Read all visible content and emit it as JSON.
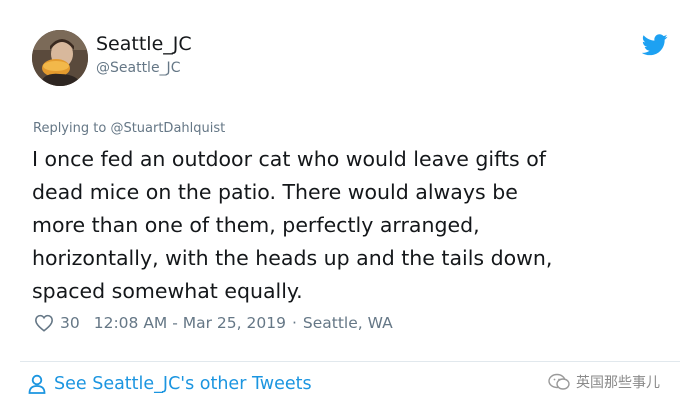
{
  "user": {
    "display_name": "Seattle_JC",
    "handle": "@Seattle_JC"
  },
  "reply": {
    "prefix": "Replying to",
    "to": "@StuartDahlquist"
  },
  "tweet": {
    "line1": "I once fed an outdoor cat who would leave gifts of",
    "line2": "dead mice on the patio. There would always be",
    "line3": "more than one of them, perfectly arranged,",
    "line4": "horizontally, with the heads up and the tails down,",
    "line5": "spaced somewhat equally."
  },
  "meta": {
    "likes": "30",
    "timestamp": "12:08 AM - Mar 25, 2019",
    "separator": "·",
    "location": "Seattle, WA"
  },
  "footer": {
    "link_label": "See Seattle_JC's other Tweets"
  },
  "watermark": {
    "text": "英国那些事儿"
  },
  "colors": {
    "link": "#1b95e0",
    "muted": "#657786",
    "text": "#14171a",
    "twitter_blue": "#1da1f2"
  },
  "icons": {
    "brand": "twitter-bird-icon",
    "like": "heart-icon",
    "profile": "person-icon"
  }
}
